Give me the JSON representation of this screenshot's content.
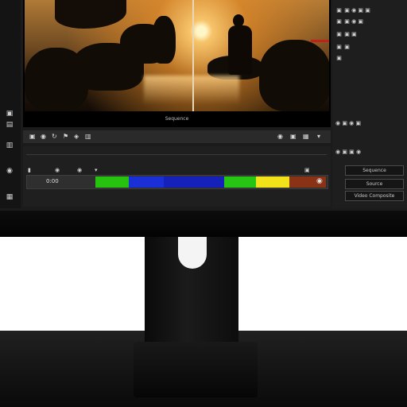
{
  "viewer": {
    "caption": "Sequence"
  },
  "timeline": {
    "track_label": "0:00",
    "segments": [
      {
        "name": "clip-green-1",
        "color": "#27c20f"
      },
      {
        "name": "clip-blue-1",
        "color": "#1a2fd6"
      },
      {
        "name": "clip-blue-2",
        "color": "#1521b8"
      },
      {
        "name": "clip-green-2",
        "color": "#26c413"
      },
      {
        "name": "clip-yellow",
        "color": "#f1e21a"
      },
      {
        "name": "clip-brown",
        "color": "#8a3216"
      }
    ]
  },
  "right_panel": {
    "field_1": "Sequence",
    "field_2": "Source",
    "field_3": "Video Composite"
  },
  "icons": [
    "playhead-icon",
    "cut-icon",
    "track-toggle-icon",
    "settings-icon"
  ]
}
